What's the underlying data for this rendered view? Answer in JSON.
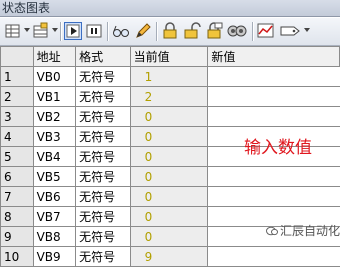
{
  "window": {
    "title": "状态图表"
  },
  "toolbar": {
    "buttons": [
      "table-icon",
      "insert-row-icon",
      "single-read-icon",
      "stop-icon",
      "glasses-icon",
      "pencil-icon",
      "lock-icon",
      "unlock-icon",
      "force-icon",
      "read-all-icon",
      "chart-icon",
      "tag-icon"
    ]
  },
  "table": {
    "headers": {
      "address": "地址",
      "format": "格式",
      "current": "当前值",
      "new": "新值"
    },
    "rows": [
      {
        "num": "1",
        "address": "VB0",
        "format": "无符号",
        "current": "1",
        "new": ""
      },
      {
        "num": "2",
        "address": "VB1",
        "format": "无符号",
        "current": "2",
        "new": ""
      },
      {
        "num": "3",
        "address": "VB2",
        "format": "无符号",
        "current": "0",
        "new": ""
      },
      {
        "num": "4",
        "address": "VB3",
        "format": "无符号",
        "current": "0",
        "new": ""
      },
      {
        "num": "5",
        "address": "VB4",
        "format": "无符号",
        "current": "0",
        "new": ""
      },
      {
        "num": "6",
        "address": "VB5",
        "format": "无符号",
        "current": "0",
        "new": ""
      },
      {
        "num": "7",
        "address": "VB6",
        "format": "无符号",
        "current": "0",
        "new": ""
      },
      {
        "num": "8",
        "address": "VB7",
        "format": "无符号",
        "current": "0",
        "new": ""
      },
      {
        "num": "9",
        "address": "VB8",
        "format": "无符号",
        "current": "0",
        "new": ""
      },
      {
        "num": "10",
        "address": "VB9",
        "format": "无符号",
        "current": "9",
        "new": ""
      }
    ]
  },
  "annotation": {
    "text": "输入数值",
    "color": "#e0171e"
  },
  "watermark": {
    "text": "汇辰自动化"
  },
  "colors": {
    "current_value_text": "#b2a000",
    "active_button": "#cfe0fb"
  }
}
